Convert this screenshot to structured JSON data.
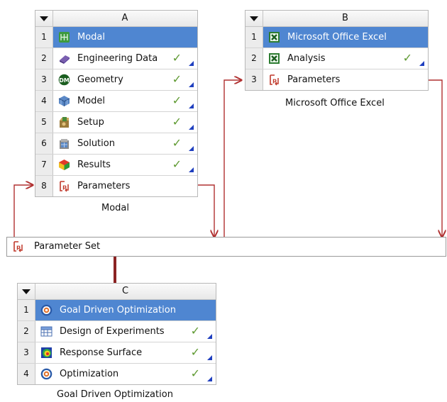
{
  "systems": {
    "A": {
      "letter": "A",
      "caption": "Modal",
      "rows": [
        {
          "num": "1",
          "label": "Modal",
          "icon": "modal-icon"
        },
        {
          "num": "2",
          "label": "Engineering Data",
          "icon": "engineering-data-icon",
          "check": "✓"
        },
        {
          "num": "3",
          "label": "Geometry",
          "icon": "geometry-icon",
          "check": "✓"
        },
        {
          "num": "4",
          "label": "Model",
          "icon": "model-icon",
          "check": "✓"
        },
        {
          "num": "5",
          "label": "Setup",
          "icon": "setup-icon",
          "check": "✓"
        },
        {
          "num": "6",
          "label": "Solution",
          "icon": "solution-icon",
          "check": "✓"
        },
        {
          "num": "7",
          "label": "Results",
          "icon": "results-icon",
          "check": "✓"
        },
        {
          "num": "8",
          "label": "Parameters",
          "icon": "parameters-icon"
        }
      ]
    },
    "B": {
      "letter": "B",
      "caption": "Microsoft Office Excel",
      "rows": [
        {
          "num": "1",
          "label": "Microsoft Office Excel",
          "icon": "excel-icon"
        },
        {
          "num": "2",
          "label": "Analysis",
          "icon": "excel-icon",
          "check": "✓"
        },
        {
          "num": "3",
          "label": "Parameters",
          "icon": "parameters-icon"
        }
      ]
    },
    "C": {
      "letter": "C",
      "caption": "Goal Driven Optimization",
      "rows": [
        {
          "num": "1",
          "label": "Goal Driven Optimization",
          "icon": "goal-driven-optimization-icon"
        },
        {
          "num": "2",
          "label": "Design of Experiments",
          "icon": "design-of-experiments-icon",
          "check": "✓"
        },
        {
          "num": "3",
          "label": "Response Surface",
          "icon": "response-surface-icon",
          "check": "✓"
        },
        {
          "num": "4",
          "label": "Optimization",
          "icon": "optimization-icon",
          "check": "✓"
        }
      ]
    }
  },
  "parameter_set": {
    "label": "Parameter Set",
    "icon": "parameters-icon"
  },
  "colors": {
    "selected_row": "#4f86d1",
    "check": "#5f9a32",
    "link": "#b03030",
    "status_triangle": "#1f3fbf"
  }
}
